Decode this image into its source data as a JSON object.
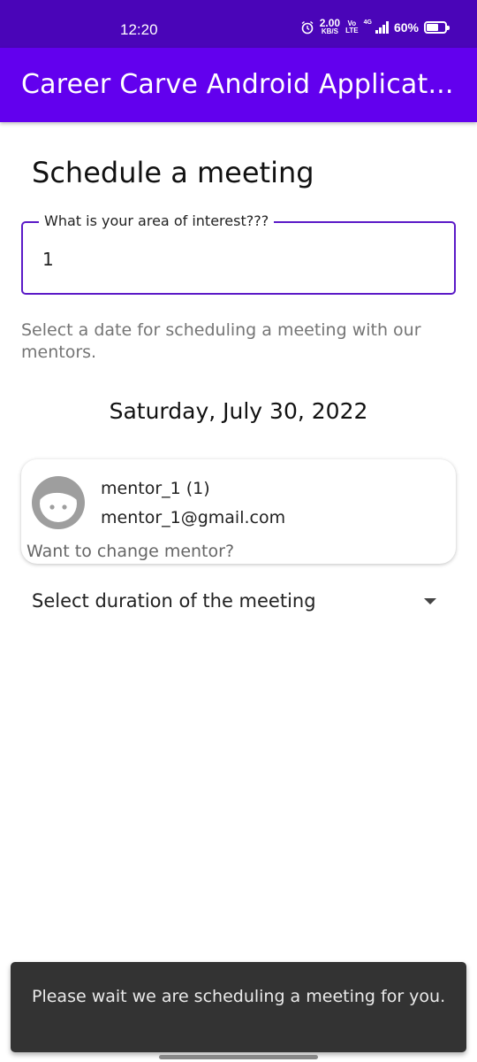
{
  "status_bar": {
    "time": "12:20",
    "net_speed_value": "2.00",
    "net_speed_unit": "KB/S",
    "volte_top": "Vo",
    "volte_bottom": "LTE",
    "network_type": "4G",
    "battery_percent": "60%",
    "icons": [
      "alarm-icon",
      "signal-icon",
      "battery-icon"
    ],
    "background_color": "#4a05b8"
  },
  "app_bar": {
    "title": "Career Carve Android Applicat...",
    "background_color": "#6200ee"
  },
  "main": {
    "title": "Schedule a meeting",
    "interest_field": {
      "label": "What is your area of interest???",
      "value": "1",
      "border_color": "#5b1ac7"
    },
    "date_hint": "Select a date for scheduling a meeting with our mentors.",
    "selected_date": "Saturday, July 30, 2022",
    "mentor_card": {
      "name": "mentor_1 (1)",
      "email": "mentor_1@gmail.com",
      "change_link": "Want to change mentor?",
      "avatar_icon": "face-avatar-icon"
    },
    "duration_select": {
      "label": "Select duration of the meeting",
      "icon": "dropdown-arrow-icon"
    }
  },
  "snackbar": {
    "message": "Please wait we are scheduling a meeting for you."
  }
}
